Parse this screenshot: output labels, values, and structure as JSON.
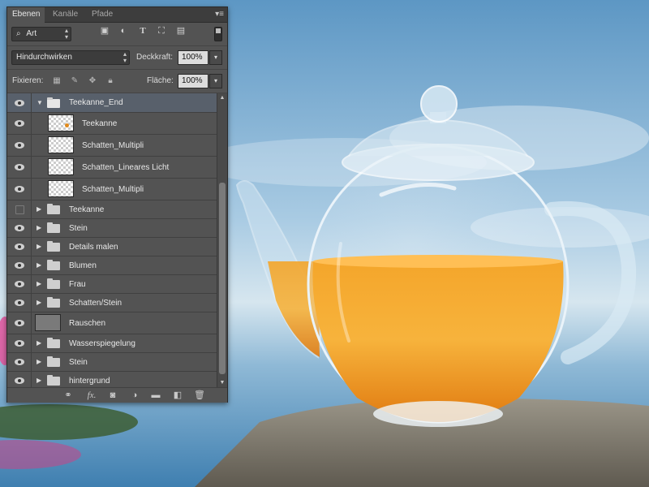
{
  "panel": {
    "tabs": [
      {
        "label": "Ebenen",
        "active": true
      },
      {
        "label": "Kanäle",
        "active": false
      },
      {
        "label": "Pfade",
        "active": false
      }
    ],
    "filter": {
      "value": "Art",
      "icon": "search-icon"
    },
    "blend_mode": "Hindurchwirken",
    "opacity_label": "Deckkraft:",
    "opacity_value": "100%",
    "lock_label": "Fixieren:",
    "fill_label": "Fläche:",
    "fill_value": "100%",
    "layers": [
      {
        "name": "Teekanne_End",
        "type": "group",
        "expanded": true,
        "selected": true,
        "visible": true
      },
      {
        "name": "Teekanne",
        "type": "layer",
        "thumb": "teapot",
        "indent": true,
        "visible": true
      },
      {
        "name": "Schatten_Multipli",
        "type": "layer",
        "thumb": "transparent",
        "indent": true,
        "visible": true
      },
      {
        "name": "Schatten_Lineares Licht",
        "type": "layer",
        "thumb": "transparent",
        "indent": true,
        "visible": true
      },
      {
        "name": "Schatten_Multipli",
        "type": "layer",
        "thumb": "transparent",
        "indent": true,
        "visible": true
      },
      {
        "name": "Teekanne",
        "type": "group",
        "visible": false
      },
      {
        "name": "Stein",
        "type": "group",
        "visible": true
      },
      {
        "name": "Details malen",
        "type": "group",
        "visible": true
      },
      {
        "name": "Blumen",
        "type": "group",
        "visible": true
      },
      {
        "name": "Frau",
        "type": "group",
        "visible": true
      },
      {
        "name": "Schatten/Stein",
        "type": "group",
        "visible": true
      },
      {
        "name": "Rauschen",
        "type": "layer",
        "thumb": "gray",
        "indent": false,
        "visible": true
      },
      {
        "name": "Wasserspiegelung",
        "type": "group",
        "visible": true
      },
      {
        "name": "Stein",
        "type": "group",
        "visible": true
      },
      {
        "name": "hintergrund",
        "type": "group",
        "visible": true
      }
    ],
    "footer_icons": [
      "link-icon",
      "fx-icon",
      "mask-icon",
      "adjustment-icon",
      "new-group-icon",
      "new-layer-icon",
      "trash-icon"
    ],
    "footer_fx_label": "fx."
  },
  "colors": {
    "panel_bg": "#535353",
    "selected_row": "#58606b",
    "tea": "#e8901a",
    "sky_top": "#5f98c4",
    "sky_bottom": "#c9dfed"
  }
}
